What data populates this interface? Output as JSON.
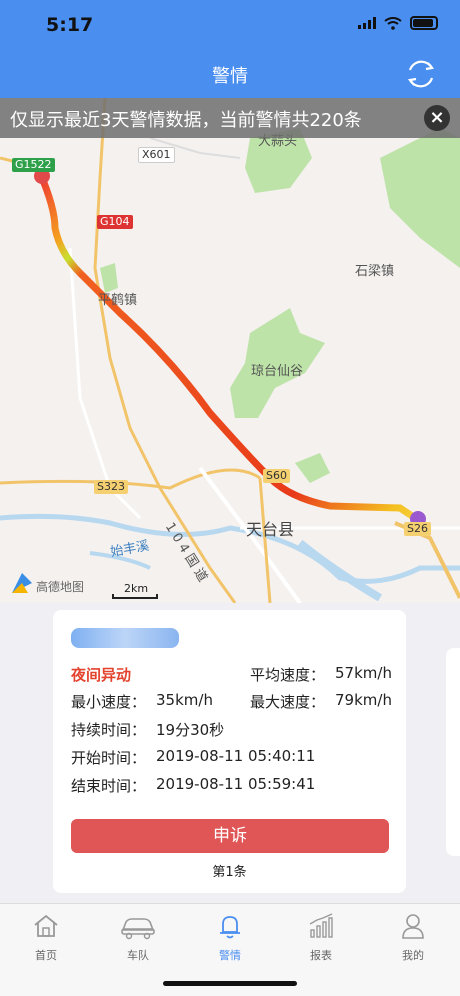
{
  "status": {
    "time": "5:17"
  },
  "nav": {
    "title": "警情"
  },
  "notice": {
    "text": "仅显示最近3天警情数据，当前警情共220条"
  },
  "map": {
    "labels": {
      "dasuantou": "大蒜头",
      "shiliang": "石梁镇",
      "pinghe": "平鹤镇",
      "qiongtai": "琼台仙谷",
      "tiantai": "天台县",
      "road104": "104国道",
      "shifeng": "始丰溪",
      "scale": "2km",
      "provider": "高德地图"
    },
    "roads": {
      "g1522": "G1522",
      "x601": "X601",
      "g104": "G104",
      "s323": "S323",
      "s60": "S60",
      "s26": "S26"
    }
  },
  "card": {
    "type": "夜间异动",
    "avg_speed_label": "平均速度：",
    "avg_speed": "57km/h",
    "min_speed_label": "最小速度：",
    "min_speed": "35km/h",
    "max_speed_label": "最大速度：",
    "max_speed": "79km/h",
    "duration_label": "持续时间：",
    "duration": "19分30秒",
    "start_label": "开始时间：",
    "start": "2019-08-11 05:40:11",
    "end_label": "结束时间：",
    "end": "2019-08-11 05:59:41",
    "appeal": "申诉",
    "page": "第1条"
  },
  "tabs": [
    {
      "label": "首页",
      "icon": "house-icon"
    },
    {
      "label": "车队",
      "icon": "car-icon"
    },
    {
      "label": "警情",
      "icon": "bell-icon"
    },
    {
      "label": "报表",
      "icon": "chart-icon"
    },
    {
      "label": "我的",
      "icon": "person-icon"
    }
  ],
  "colors": {
    "primary": "#4a8ef0",
    "alert": "#e3432d",
    "appeal": "#e05555"
  }
}
